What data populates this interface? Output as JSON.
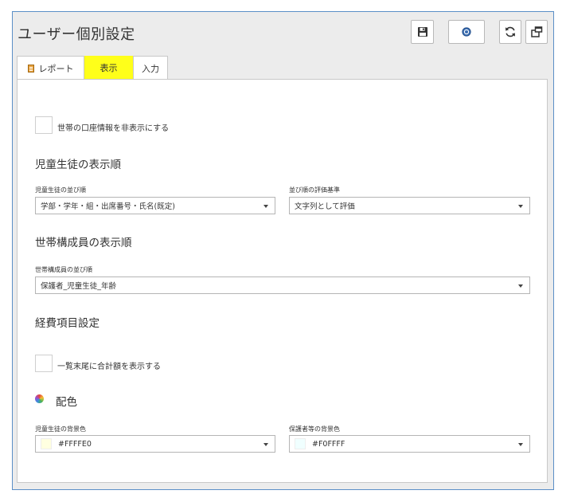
{
  "window": {
    "title": "ユーザー個別設定"
  },
  "toolbar": {
    "buttons": [
      {
        "name": "save",
        "icon": "floppy-disk-icon"
      },
      {
        "name": "help",
        "icon": "help-circle-icon"
      },
      {
        "name": "refresh",
        "icon": "refresh-icon"
      },
      {
        "name": "popout",
        "icon": "window-popout-icon"
      }
    ]
  },
  "tabs": {
    "report": "レポート",
    "display": "表示",
    "input": "入力",
    "selected": "display",
    "highlight_color": "#ffff1a"
  },
  "settings": {
    "hide_account_info": {
      "label": "世帯の口座情報を非表示にする",
      "checked": false
    },
    "student_order": {
      "heading": "児童生徒の表示順",
      "sort_label": "児童生徒の並び順",
      "sort_value": "学部・学年・組・出席番号・氏名(既定)",
      "criteria_label": "並び順の評価基準",
      "criteria_value": "文字列として評価"
    },
    "member_order": {
      "heading": "世帯構成員の表示順",
      "sort_label": "世帯構成員の並び順",
      "sort_value": "保護者_児童生徒_年齢"
    },
    "expense": {
      "heading": "経費項目設定",
      "show_total": {
        "label": "一覧末尾に合計額を表示する",
        "checked": false
      }
    },
    "colors": {
      "heading": "配色",
      "student_bg_label": "児童生徒の背景色",
      "student_bg_value": "#FFFFE0",
      "guardian_bg_label": "保護者等の背景色",
      "guardian_bg_value": "#F0FFFF"
    }
  }
}
